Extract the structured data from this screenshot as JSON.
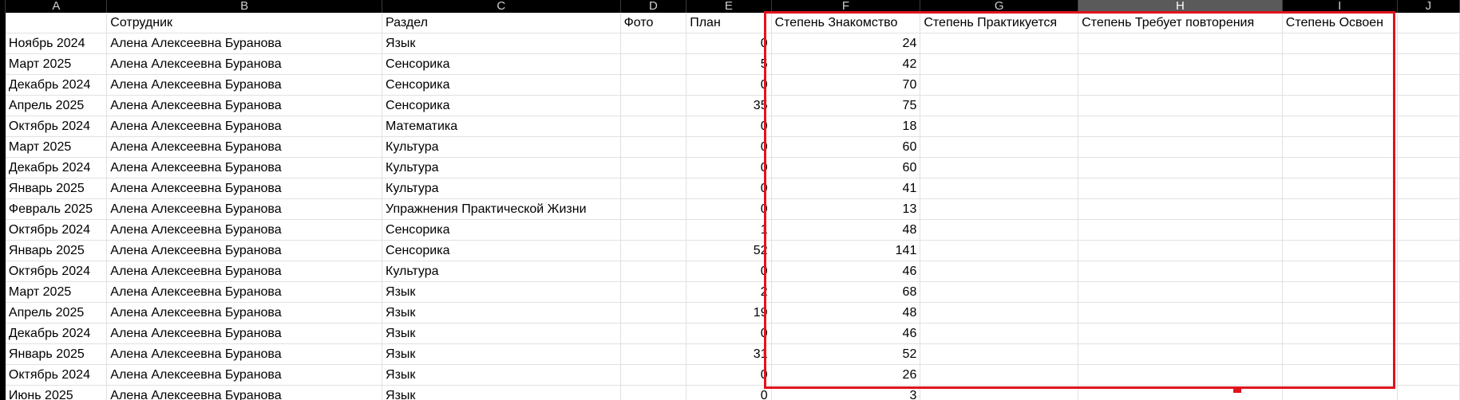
{
  "columns": [
    "A",
    "B",
    "C",
    "D",
    "E",
    "F",
    "G",
    "H",
    "I",
    "J"
  ],
  "header_row": [
    "",
    "Сотрудник",
    "Раздел",
    "Фото",
    "План",
    "Степень Знакомство",
    "Степень Практикуется",
    "Степень Требует повторения",
    "Степень Освоен",
    ""
  ],
  "rows": [
    {
      "a": "Ноябрь 2024",
      "b": "Алена Алексеевна Буранова",
      "c": "Язык",
      "e": "0",
      "f": "24"
    },
    {
      "a": "Март 2025",
      "b": "Алена Алексеевна Буранова",
      "c": "Сенсорика",
      "e": "5",
      "f": "42"
    },
    {
      "a": "Декабрь 2024",
      "b": "Алена Алексеевна Буранова",
      "c": "Сенсорика",
      "e": "0",
      "f": "70"
    },
    {
      "a": "Апрель 2025",
      "b": "Алена Алексеевна Буранова",
      "c": "Сенсорика",
      "e": "35",
      "f": "75"
    },
    {
      "a": "Октябрь 2024",
      "b": "Алена Алексеевна Буранова",
      "c": "Математика",
      "e": "0",
      "f": "18"
    },
    {
      "a": "Март 2025",
      "b": "Алена Алексеевна Буранова",
      "c": "Культура",
      "e": "0",
      "f": "60"
    },
    {
      "a": "Декабрь 2024",
      "b": "Алена Алексеевна Буранова",
      "c": "Культура",
      "e": "0",
      "f": "60"
    },
    {
      "a": "Январь 2025",
      "b": "Алена Алексеевна Буранова",
      "c": "Культура",
      "e": "0",
      "f": "41"
    },
    {
      "a": "Февраль 2025",
      "b": "Алена Алексеевна Буранова",
      "c": "Упражнения Практической Жизни",
      "e": "0",
      "f": "13"
    },
    {
      "a": "Октябрь 2024",
      "b": "Алена Алексеевна Буранова",
      "c": "Сенсорика",
      "e": "1",
      "f": "48"
    },
    {
      "a": "Январь 2025",
      "b": "Алена Алексеевна Буранова",
      "c": "Сенсорика",
      "e": "52",
      "f": "141"
    },
    {
      "a": "Октябрь 2024",
      "b": "Алена Алексеевна Буранова",
      "c": "Культура",
      "e": "0",
      "f": "46"
    },
    {
      "a": "Март 2025",
      "b": "Алена Алексеевна Буранова",
      "c": "Язык",
      "e": "2",
      "f": "68"
    },
    {
      "a": "Апрель 2025",
      "b": "Алена Алексеевна Буранова",
      "c": "Язык",
      "e": "19",
      "f": "48"
    },
    {
      "a": "Декабрь 2024",
      "b": "Алена Алексеевна Буранова",
      "c": "Язык",
      "e": "0",
      "f": "46"
    },
    {
      "a": "Январь 2025",
      "b": "Алена Алексеевна Буранова",
      "c": "Язык",
      "e": "31",
      "f": "52"
    },
    {
      "a": "Октябрь 2024",
      "b": "Алена Алексеевна Буранова",
      "c": "Язык",
      "e": "0",
      "f": "26"
    },
    {
      "a": "Июнь 2025",
      "b": "Алена Алексеевна Буранова",
      "c": "Язык",
      "e": "0",
      "f": "3"
    }
  ],
  "selected_column": "H",
  "colors": {
    "selection": "#e0141e",
    "header_bg": "#000000",
    "header_selected_bg": "#5a5a5a"
  }
}
